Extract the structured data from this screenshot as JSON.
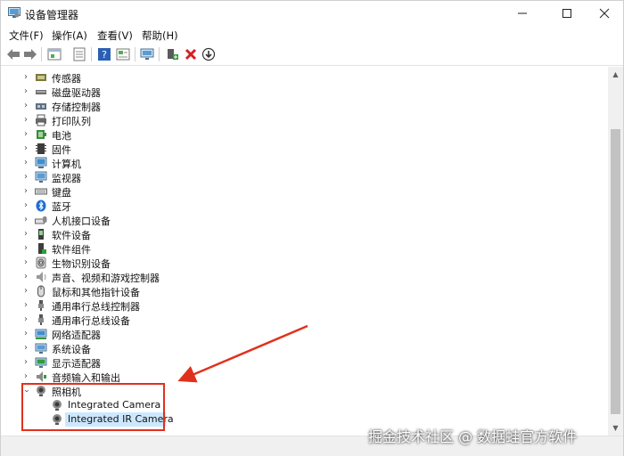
{
  "window": {
    "title": "设备管理器",
    "controls": {
      "minimize": "—",
      "maximize": "☐",
      "close": "✕"
    }
  },
  "menubar": {
    "items": [
      {
        "label": "文件(F)"
      },
      {
        "label": "操作(A)"
      },
      {
        "label": "查看(V)"
      },
      {
        "label": "帮助(H)"
      }
    ]
  },
  "toolbar": {
    "buttons": [
      "back-arrow-icon",
      "forward-arrow-icon",
      "properties-icon",
      "list-icon",
      "help-icon",
      "view-icon",
      "monitor-icon",
      "add-driver-icon",
      "uninstall-icon",
      "download-icon"
    ]
  },
  "tree": {
    "categories": [
      {
        "label": "传感器",
        "icon": "sensor-icon"
      },
      {
        "label": "磁盘驱动器",
        "icon": "disk-icon"
      },
      {
        "label": "存储控制器",
        "icon": "storage-icon"
      },
      {
        "label": "打印队列",
        "icon": "printer-icon"
      },
      {
        "label": "电池",
        "icon": "battery-icon"
      },
      {
        "label": "固件",
        "icon": "firmware-icon"
      },
      {
        "label": "计算机",
        "icon": "computer-icon"
      },
      {
        "label": "监视器",
        "icon": "monitor-icon"
      },
      {
        "label": "键盘",
        "icon": "keyboard-icon"
      },
      {
        "label": "蓝牙",
        "icon": "bluetooth-icon"
      },
      {
        "label": "人机接口设备",
        "icon": "hid-icon"
      },
      {
        "label": "软件设备",
        "icon": "software-device-icon"
      },
      {
        "label": "软件组件",
        "icon": "software-component-icon"
      },
      {
        "label": "生物识别设备",
        "icon": "biometric-icon"
      },
      {
        "label": "声音、视频和游戏控制器",
        "icon": "sound-icon"
      },
      {
        "label": "鼠标和其他指针设备",
        "icon": "mouse-icon"
      },
      {
        "label": "通用串行总线控制器",
        "icon": "usb-icon"
      },
      {
        "label": "通用串行总线设备",
        "icon": "usb-device-icon"
      },
      {
        "label": "网络适配器",
        "icon": "network-icon"
      },
      {
        "label": "系统设备",
        "icon": "system-icon"
      },
      {
        "label": "显示适配器",
        "icon": "display-adapter-icon"
      },
      {
        "label": "音频输入和输出",
        "icon": "audio-icon"
      }
    ],
    "expanded": {
      "label": "照相机",
      "icon": "camera-icon",
      "children": [
        {
          "label": "Integrated Camera",
          "icon": "camera-icon"
        },
        {
          "label": "Integrated IR Camera",
          "icon": "camera-icon",
          "selected": true
        }
      ]
    }
  },
  "watermark": "掘金技术社区 @ 数据蛙官方软件",
  "colors": {
    "annotation": "#e0311d",
    "selection": "#cce8ff"
  }
}
